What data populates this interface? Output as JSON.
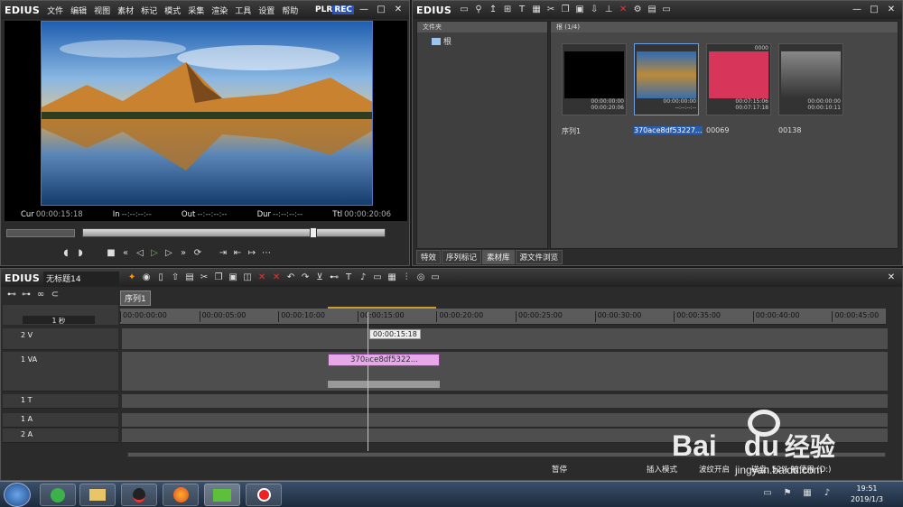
{
  "player": {
    "logo": "EDIUS",
    "menu": [
      "文件",
      "编辑",
      "视图",
      "素材",
      "标记",
      "模式",
      "采集",
      "渲染",
      "工具",
      "设置",
      "帮助"
    ],
    "plr": "PLR",
    "rec": "REC",
    "cur_label": "Cur",
    "cur": "00:00:15:18",
    "in_label": "In",
    "in": "--:--:--:--",
    "out_label": "Out",
    "out": "--:--:--:--",
    "dur_label": "Dur",
    "dur": "--:--:--:--",
    "ttl_label": "Ttl",
    "ttl": "00:00:20:06"
  },
  "bin": {
    "logo": "EDIUS",
    "folder_header": "文件夹",
    "root": "根",
    "path": "根 (1/4)",
    "clips": [
      {
        "label": "序列1",
        "tc1": "00:00:00:00",
        "tc2": "00:00:20:06"
      },
      {
        "label": "370ace8df53227...",
        "tc1": "00:00:00:00",
        "tc2": "--:--:--:--"
      },
      {
        "label": "00069",
        "tc1": "00:07:15:06",
        "tc2": "00:07:17:18",
        "tag": "0000"
      },
      {
        "label": "00138",
        "tc1": "00:00:00:00",
        "tc2": "00:00:10:11"
      }
    ],
    "tabs": [
      "特效",
      "序列标记",
      "素材库",
      "源文件浏览"
    ]
  },
  "timeline": {
    "logo": "EDIUS",
    "project": "无标题14",
    "sequence_tab": "序列1",
    "scale": "1 秒",
    "ruler": [
      "00:00:00:00",
      "00:00:05:00",
      "00:00:10:00",
      "00:00:15:00",
      "00:00:20:00",
      "00:00:25:00",
      "00:00:30:00",
      "00:00:35:00",
      "00:00:40:00",
      "00:00:45:00"
    ],
    "tracks": [
      "2 V",
      "1 VA",
      "1 T",
      "1 A",
      "2 A"
    ],
    "clip": "370ace8df5322...",
    "cursor_tc": "00:00:15:18",
    "status": {
      "pause": "暂停",
      "insert": "插入模式",
      "ripple": "波纹开启",
      "disk": "磁盘: 52% 被使用 (D:)"
    }
  },
  "taskbar": {
    "time": "19:51",
    "date": "2019/1/3"
  },
  "watermark": {
    "brand": "Bai",
    "brand2": "du",
    "cn": "经验",
    "url": "jingyan.baidu.com"
  }
}
